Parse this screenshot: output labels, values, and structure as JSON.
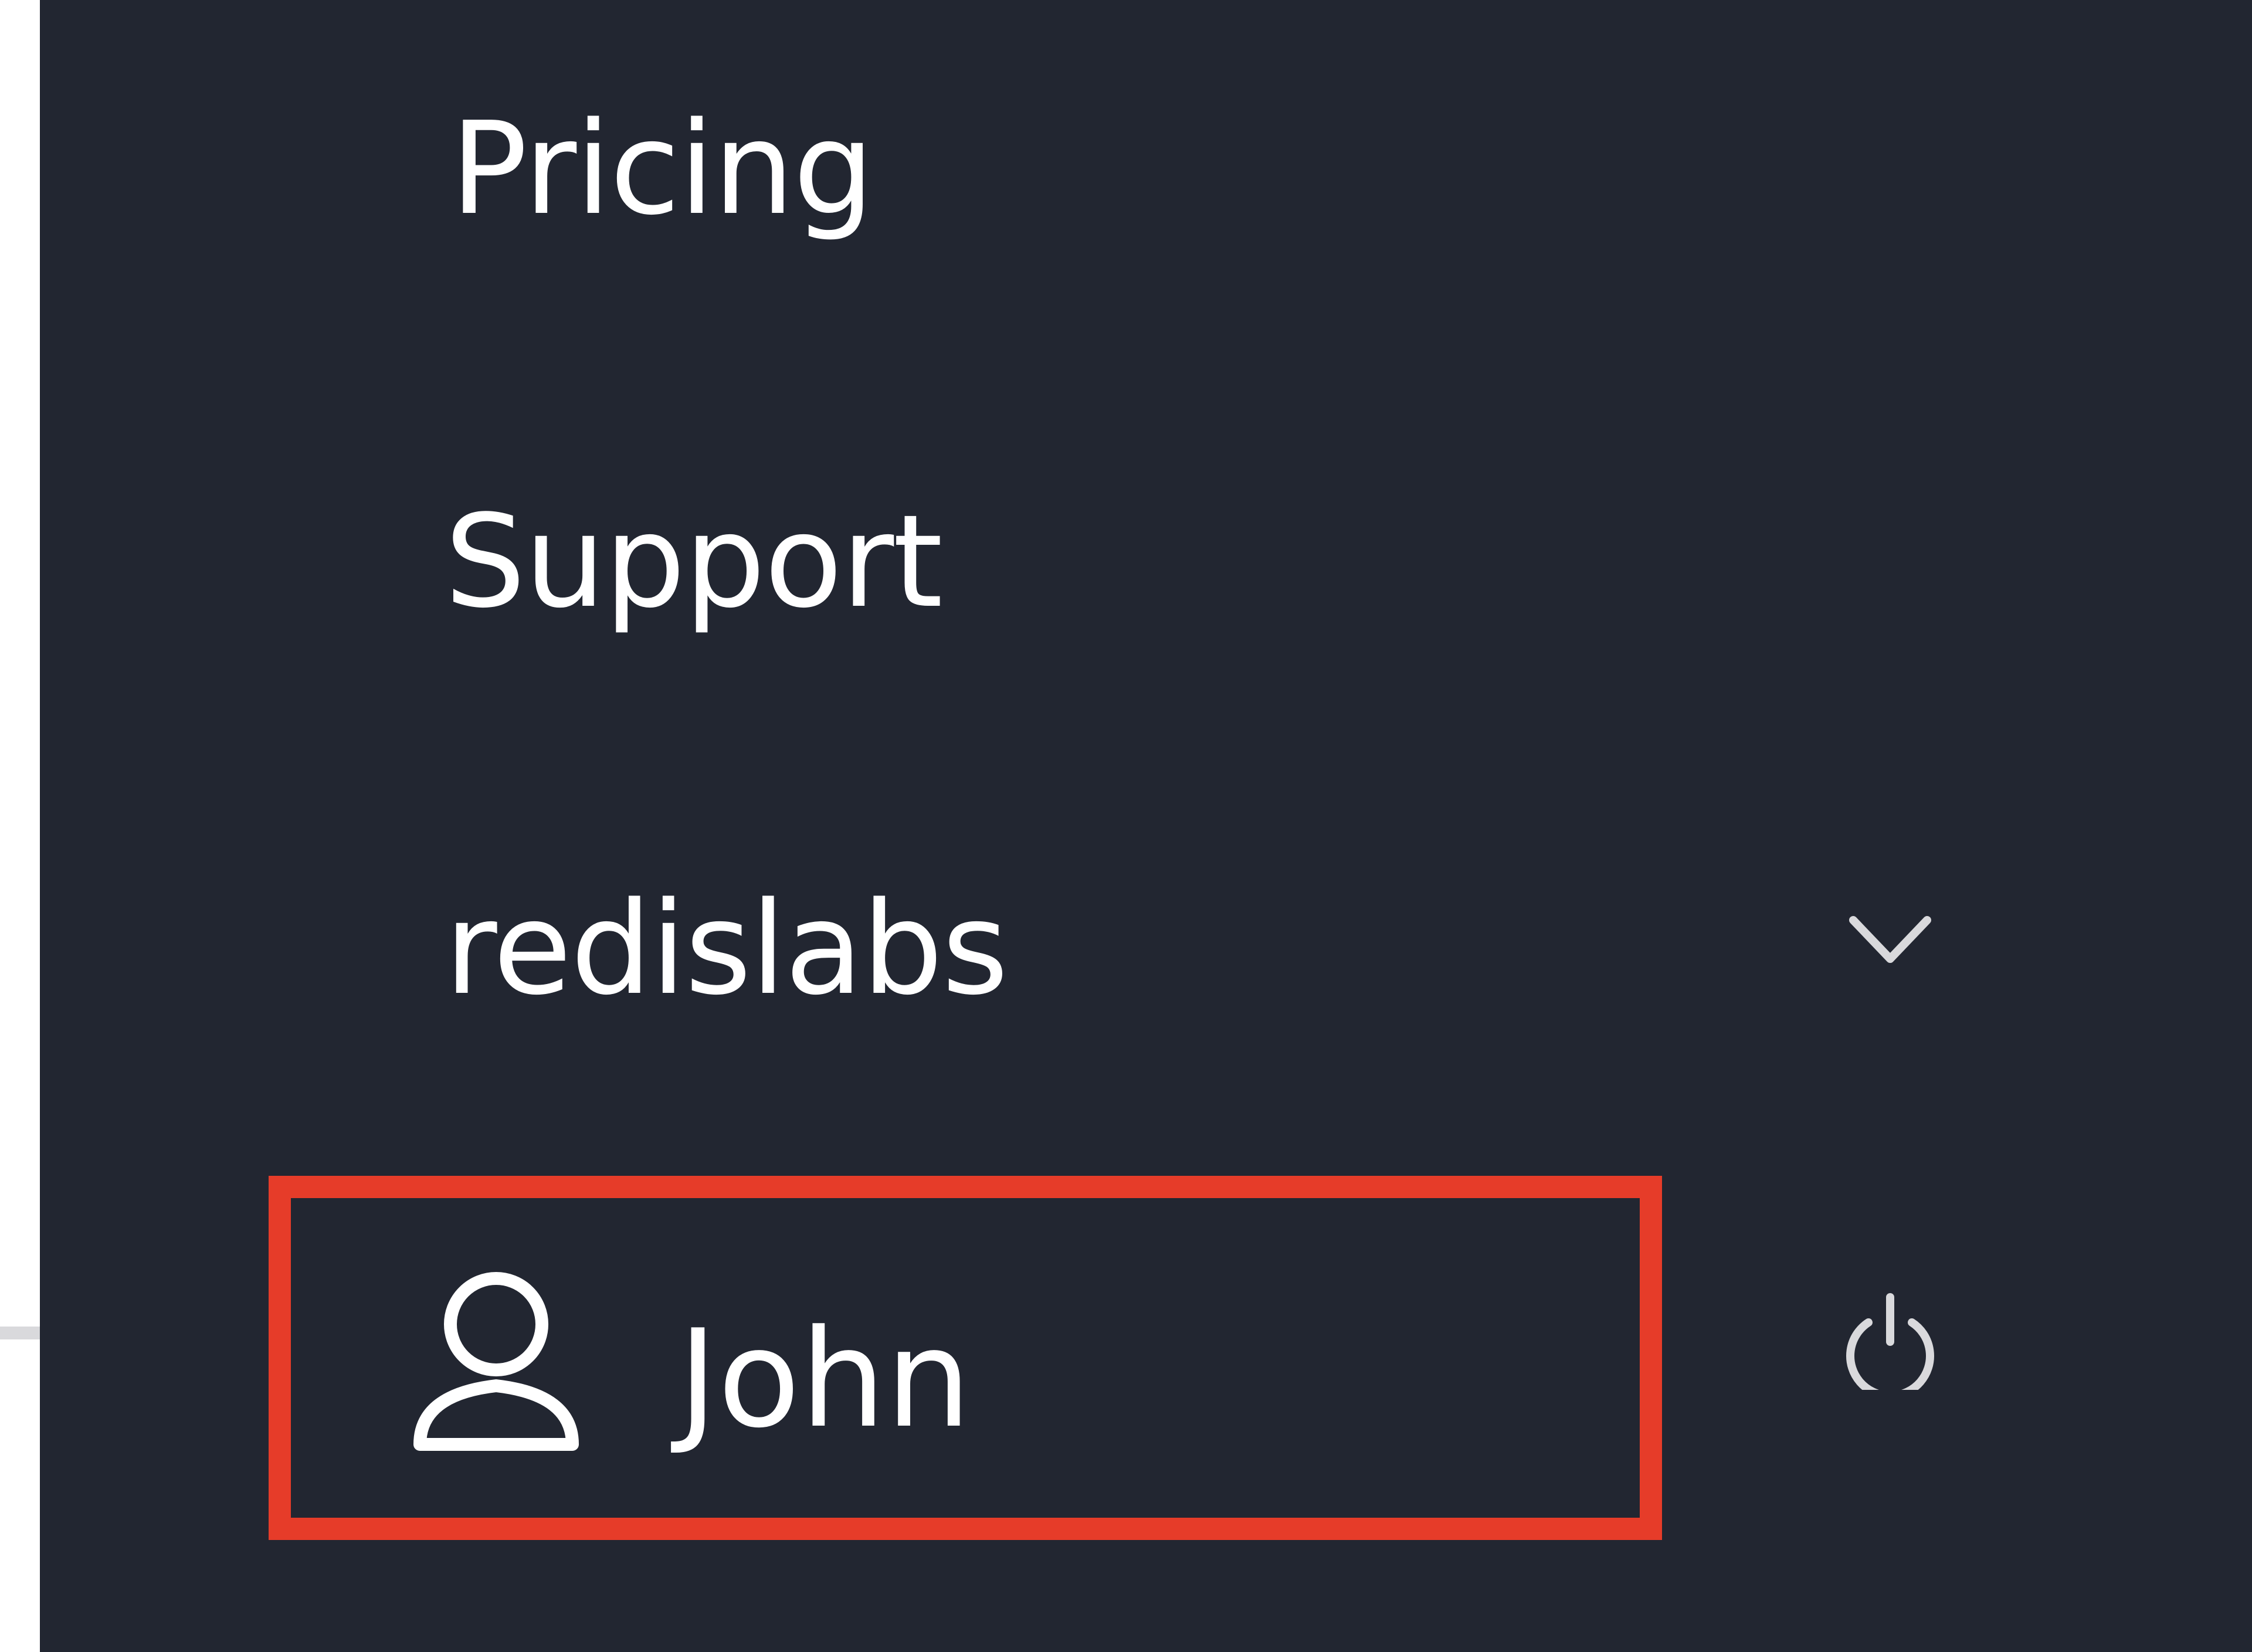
{
  "nav": {
    "pricing": "Pricing",
    "support": "Support",
    "organization": "redislabs"
  },
  "user": {
    "name": "John"
  },
  "icons": {
    "organization_toggle": "chevron-down-icon",
    "user": "user-icon",
    "logout": "power-icon"
  },
  "colors": {
    "sidebar_bg": "#222631",
    "text": "#ffffff",
    "highlight": "#e63c29"
  }
}
